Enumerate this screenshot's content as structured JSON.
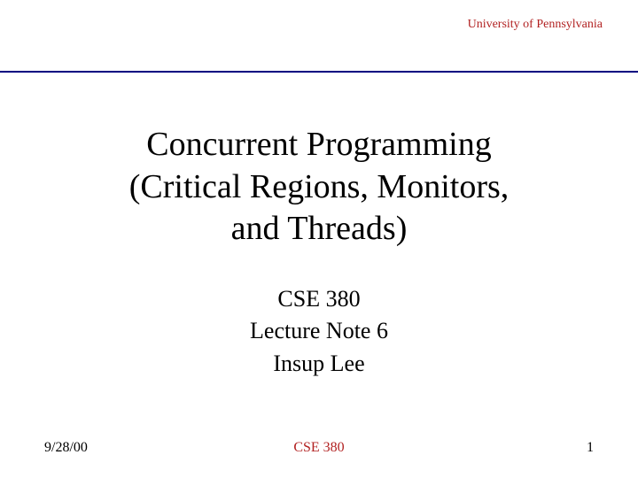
{
  "header": {
    "university": "University of Pennsylvania"
  },
  "title": {
    "line1": "Concurrent Programming",
    "line2": "(Critical Regions, Monitors,",
    "line3": "and Threads)"
  },
  "subtitle": {
    "course": "CSE 380",
    "lecture": "Lecture Note 6",
    "author": "Insup Lee"
  },
  "footer": {
    "date": "9/28/00",
    "course": "CSE 380",
    "page": "1"
  }
}
